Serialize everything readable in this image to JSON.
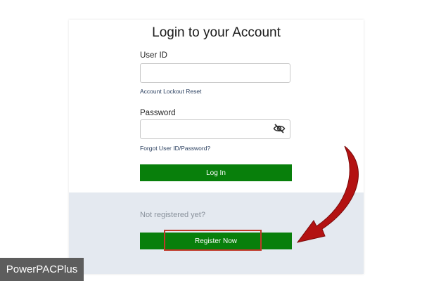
{
  "form": {
    "title": "Login to your Account",
    "user_id_label": "User ID",
    "user_id_value": "",
    "lockout_link": "Account Lockout Reset",
    "password_label": "Password",
    "password_value": "",
    "password_toggle_icon": "eye-slash-icon",
    "forgot_link": "Forgot User ID/Password?",
    "login_button": "Log In"
  },
  "register": {
    "prompt": "Not registered yet?",
    "button": "Register Now"
  },
  "annotation": {
    "highlight_color": "#c0392b",
    "arrow_color": "#b31212"
  },
  "watermark": {
    "text": "PowerPACPlus"
  },
  "colors": {
    "primary_button": "#087f0b",
    "footer_bg": "#e4e9f0"
  }
}
